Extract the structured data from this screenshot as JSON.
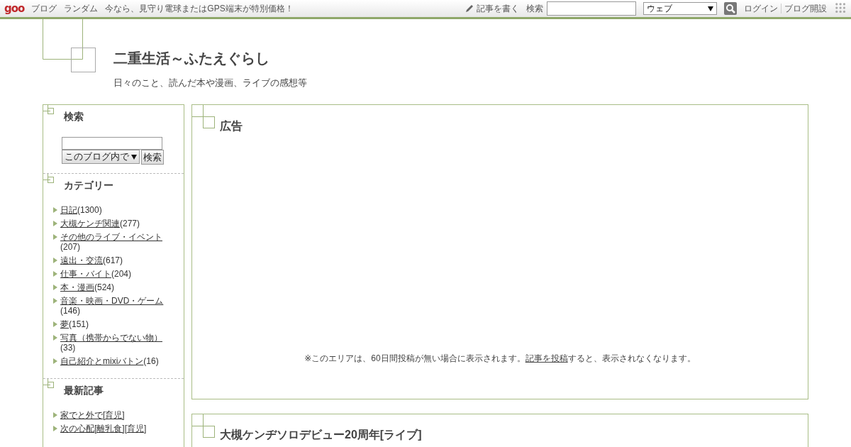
{
  "topbar": {
    "logo": "goo",
    "links": [
      "ブログ",
      "ランダム",
      "今なら、見守り電球またはGPS端末が特別価格！"
    ],
    "write": "記事を書く",
    "search_label": "検索",
    "search_scope": "ウェブ",
    "login": "ログイン",
    "open_blog": "ブログ開設"
  },
  "header": {
    "title": "二重生活～ふたえぐらし",
    "description": "日々のこと、読んだ本や漫画、ライブの感想等"
  },
  "sidebar": {
    "search": {
      "heading": "検索",
      "scope": "このブログ内で",
      "button": "検索"
    },
    "categories": {
      "heading": "カテゴリー",
      "items": [
        {
          "name": "日記",
          "count": "(1300)"
        },
        {
          "name": "大槻ケンヂ関連",
          "count": "(277)"
        },
        {
          "name": "その他のライブ・イベント",
          "count": "(207)"
        },
        {
          "name": "遠出・交流",
          "count": "(617)"
        },
        {
          "name": "仕事・バイト",
          "count": "(204)"
        },
        {
          "name": "本・漫画",
          "count": "(524)"
        },
        {
          "name": "音楽・映画・DVD・ゲーム",
          "count": "(146)"
        },
        {
          "name": "夢",
          "count": "(151)"
        },
        {
          "name": "写真（携帯からでない物）",
          "count": "(33)"
        },
        {
          "name": "自己紹介とmixiバトン",
          "count": "(16)"
        }
      ]
    },
    "recent": {
      "heading": "最新記事",
      "items": [
        {
          "title": "家でと外で",
          "tags": [
            "[育児]"
          ]
        },
        {
          "title": "次の心配",
          "tags": [
            "[離乳食]",
            "[育児]"
          ]
        }
      ]
    }
  },
  "main": {
    "ad": {
      "heading": "広告",
      "note_before": "※このエリアは、60日間投稿が無い場合に表示されます。",
      "note_link": "記事を投稿",
      "note_after": "すると、表示されなくなります。"
    },
    "entry": {
      "title": "大槻ケンヂソロデビュー20周年[ライブ]"
    }
  }
}
